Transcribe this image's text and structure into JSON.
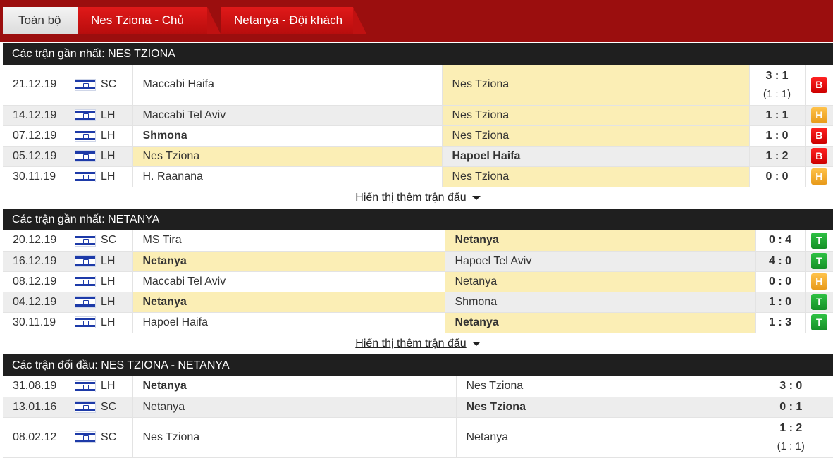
{
  "tabs": [
    {
      "label": "Toàn bộ",
      "active": true
    },
    {
      "label": "Nes Tziona - Chủ nhà",
      "active": false
    },
    {
      "label": "Netanya - Đội khách",
      "active": false
    }
  ],
  "colors": {
    "header_red": "#9b0e0e",
    "highlight": "#fbeeb5",
    "loss": "#e01010",
    "draw": "#f5a623",
    "win": "#1fa832"
  },
  "sections": [
    {
      "title": "Các trận gần nhất: NES TZIONA",
      "more_label": "Hiển thị thêm trận đấu",
      "matches": [
        {
          "date": "21.12.19",
          "comp": "SC",
          "home": "Maccabi Haifa",
          "away": "Nes Tziona",
          "score": "3 : 1",
          "ht": "(1 : 1)",
          "result": "B",
          "home_bold": false,
          "away_bold": false,
          "hl": "away"
        },
        {
          "date": "14.12.19",
          "comp": "LH",
          "home": "Maccabi Tel Aviv",
          "away": "Nes Tziona",
          "score": "1 : 1",
          "ht": "",
          "result": "H",
          "home_bold": false,
          "away_bold": false,
          "hl": "away"
        },
        {
          "date": "07.12.19",
          "comp": "LH",
          "home": "Shmona",
          "away": "Nes Tziona",
          "score": "1 : 0",
          "ht": "",
          "result": "B",
          "home_bold": true,
          "away_bold": false,
          "hl": "away"
        },
        {
          "date": "05.12.19",
          "comp": "LH",
          "home": "Nes Tziona",
          "away": "Hapoel Haifa",
          "score": "1 : 2",
          "ht": "",
          "result": "B",
          "home_bold": false,
          "away_bold": true,
          "hl": "home"
        },
        {
          "date": "30.11.19",
          "comp": "LH",
          "home": "H. Raanana",
          "away": "Nes Tziona",
          "score": "0 : 0",
          "ht": "",
          "result": "H",
          "home_bold": false,
          "away_bold": false,
          "hl": "away"
        }
      ]
    },
    {
      "title": "Các trận gần nhất: NETANYA",
      "more_label": "Hiển thị thêm trận đấu",
      "matches": [
        {
          "date": "20.12.19",
          "comp": "SC",
          "home": "MS Tira",
          "away": "Netanya",
          "score": "0 : 4",
          "ht": "",
          "result": "T",
          "home_bold": false,
          "away_bold": true,
          "hl": "away"
        },
        {
          "date": "16.12.19",
          "comp": "LH",
          "home": "Netanya",
          "away": "Hapoel Tel Aviv",
          "score": "4 : 0",
          "ht": "",
          "result": "T",
          "home_bold": true,
          "away_bold": false,
          "hl": "home"
        },
        {
          "date": "08.12.19",
          "comp": "LH",
          "home": "Maccabi Tel Aviv",
          "away": "Netanya",
          "score": "0 : 0",
          "ht": "",
          "result": "H",
          "home_bold": false,
          "away_bold": false,
          "hl": "away"
        },
        {
          "date": "04.12.19",
          "comp": "LH",
          "home": "Netanya",
          "away": "Shmona",
          "score": "1 : 0",
          "ht": "",
          "result": "T",
          "home_bold": true,
          "away_bold": false,
          "hl": "home"
        },
        {
          "date": "30.11.19",
          "comp": "LH",
          "home": "Hapoel Haifa",
          "away": "Netanya",
          "score": "1 : 3",
          "ht": "",
          "result": "T",
          "home_bold": false,
          "away_bold": true,
          "hl": "away"
        }
      ]
    },
    {
      "title": "Các trận đối đầu: NES TZIONA - NETANYA",
      "matches": [
        {
          "date": "31.08.19",
          "comp": "LH",
          "home": "Netanya",
          "away": "Nes Tziona",
          "score": "3 : 0",
          "ht": "",
          "home_bold": true,
          "away_bold": false
        },
        {
          "date": "13.01.16",
          "comp": "SC",
          "home": "Netanya",
          "away": "Nes Tziona",
          "score": "0 : 1",
          "ht": "",
          "home_bold": false,
          "away_bold": true
        },
        {
          "date": "08.02.12",
          "comp": "SC",
          "home": "Nes Tziona",
          "away": "Netanya",
          "score": "1 : 2",
          "ht": "(1 : 1)",
          "home_bold": false,
          "away_bold": false
        }
      ]
    }
  ]
}
